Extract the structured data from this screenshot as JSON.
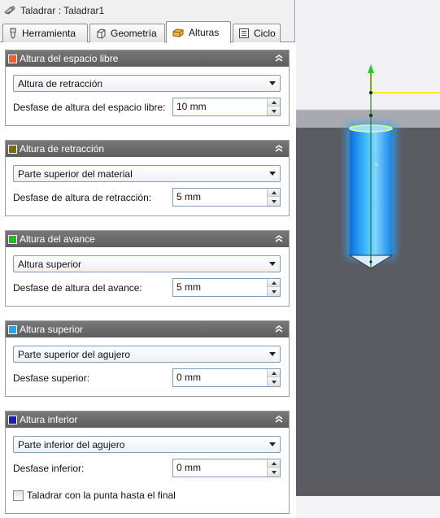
{
  "window": {
    "title": "Taladrar : Taladrar1"
  },
  "tabs": [
    {
      "label": "Herramienta",
      "icon": "drill-tool-icon"
    },
    {
      "label": "Geometría",
      "icon": "geometry-cube-icon"
    },
    {
      "label": "Alturas",
      "icon": "heights-icon",
      "active": true
    },
    {
      "label": "Ciclo",
      "icon": "cycle-list-icon"
    }
  ],
  "groups": [
    {
      "title": "Altura del espacio libre",
      "color": "#f06030",
      "option": "Altura de retracción",
      "field_label": "Desfase de altura del espacio libre:",
      "value": "10 mm"
    },
    {
      "title": "Altura de retracción",
      "color": "#7a6a10",
      "option": "Parte superior del material",
      "field_label": "Desfase de altura de retracción:",
      "value": "5 mm"
    },
    {
      "title": "Altura del avance",
      "color": "#22bb22",
      "option": "Altura superior",
      "field_label": "Desfase de altura del avance:",
      "value": "5 mm"
    },
    {
      "title": "Altura superior",
      "color": "#2aa2ee",
      "option": "Parte superior del agujero",
      "field_label": "Desfase superior:",
      "value": "0 mm"
    },
    {
      "title": "Altura inferior",
      "color": "#1a1ab8",
      "option": "Parte inferior del agujero",
      "field_label": "Desfase inferior:",
      "value": "0 mm"
    }
  ],
  "checkbox": {
    "label": "Taladrar con la punta hasta el final",
    "checked": false
  },
  "viewport": {
    "stock_top_color": "#f2f2f6",
    "stock_side_color": "#5b5b62",
    "tool_color": "#2fa8ff",
    "retract_color": "#f0f000",
    "feed_color": "#22cc22"
  }
}
